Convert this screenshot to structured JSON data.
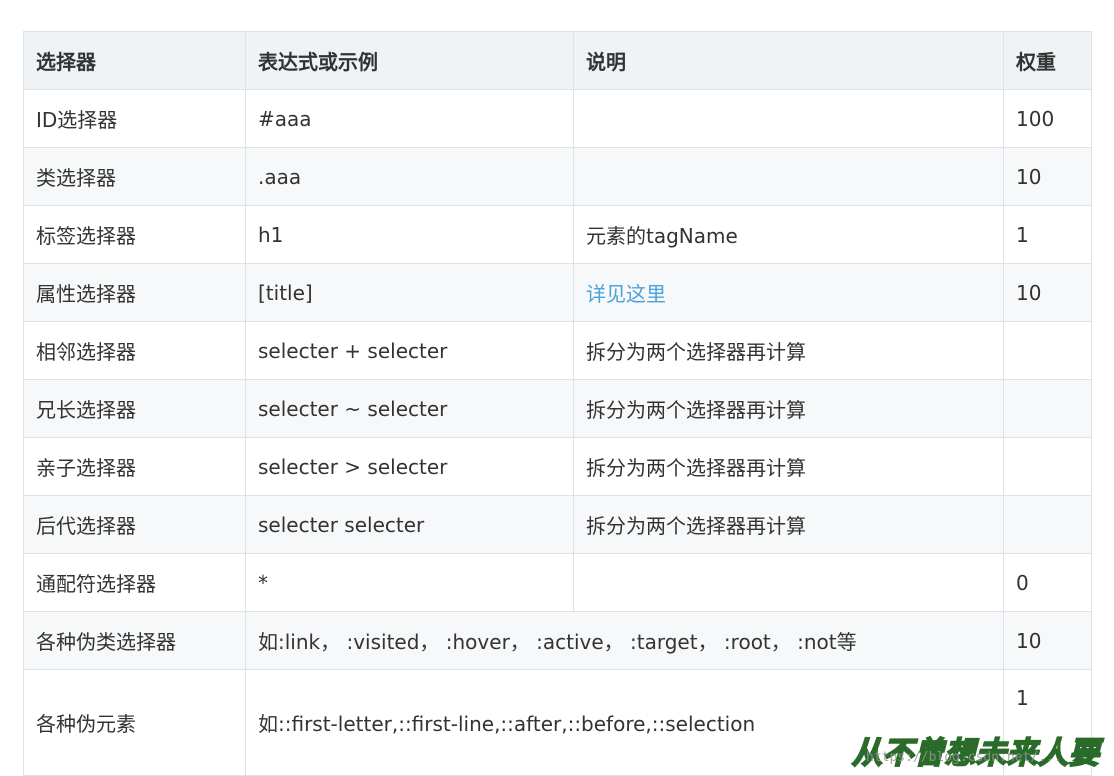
{
  "table": {
    "headers": [
      "选择器",
      "表达式或示例",
      "说明",
      "权重"
    ],
    "rows": [
      {
        "selector": "ID选择器",
        "example": "#aaa",
        "desc": "",
        "weight": "100"
      },
      {
        "selector": "类选择器",
        "example": ".aaa",
        "desc": "",
        "weight": "10"
      },
      {
        "selector": "标签选择器",
        "example": "h1",
        "desc": "元素的tagName",
        "weight": "1"
      },
      {
        "selector": "属性选择器",
        "example": "[title]",
        "desc": "详见这里",
        "weight": "10"
      },
      {
        "selector": "相邻选择器",
        "example": "selecter + selecter",
        "desc": "拆分为两个选择器再计算",
        "weight": ""
      },
      {
        "selector": "兄长选择器",
        "example": "selecter ~ selecter",
        "desc": "拆分为两个选择器再计算",
        "weight": ""
      },
      {
        "selector": "亲子选择器",
        "example": "selecter > selecter",
        "desc": "拆分为两个选择器再计算",
        "weight": ""
      },
      {
        "selector": "后代选择器",
        "example": "selecter selecter",
        "desc": "拆分为两个选择器再计算",
        "weight": ""
      },
      {
        "selector": "通配符选择器",
        "example": "*",
        "desc": "",
        "weight": "0"
      },
      {
        "selector": "各种伪类选择器",
        "example": "如:link， :visited， :hover， :active， :target， :root， :not等",
        "weight": "10"
      },
      {
        "selector": "各种伪元素",
        "example": "如::first-letter,::first-line,::after,::before,::selection",
        "weight": "1"
      }
    ]
  },
  "watermark": {
    "text": "从不曾想未来人要",
    "url_fragment": "https://blog.csdn.net/..."
  },
  "colors": {
    "header_bg": "#eff3f5",
    "stripe_bg": "#f6f8fa",
    "border": "#dfe2e5",
    "link": "#4ea1db"
  }
}
